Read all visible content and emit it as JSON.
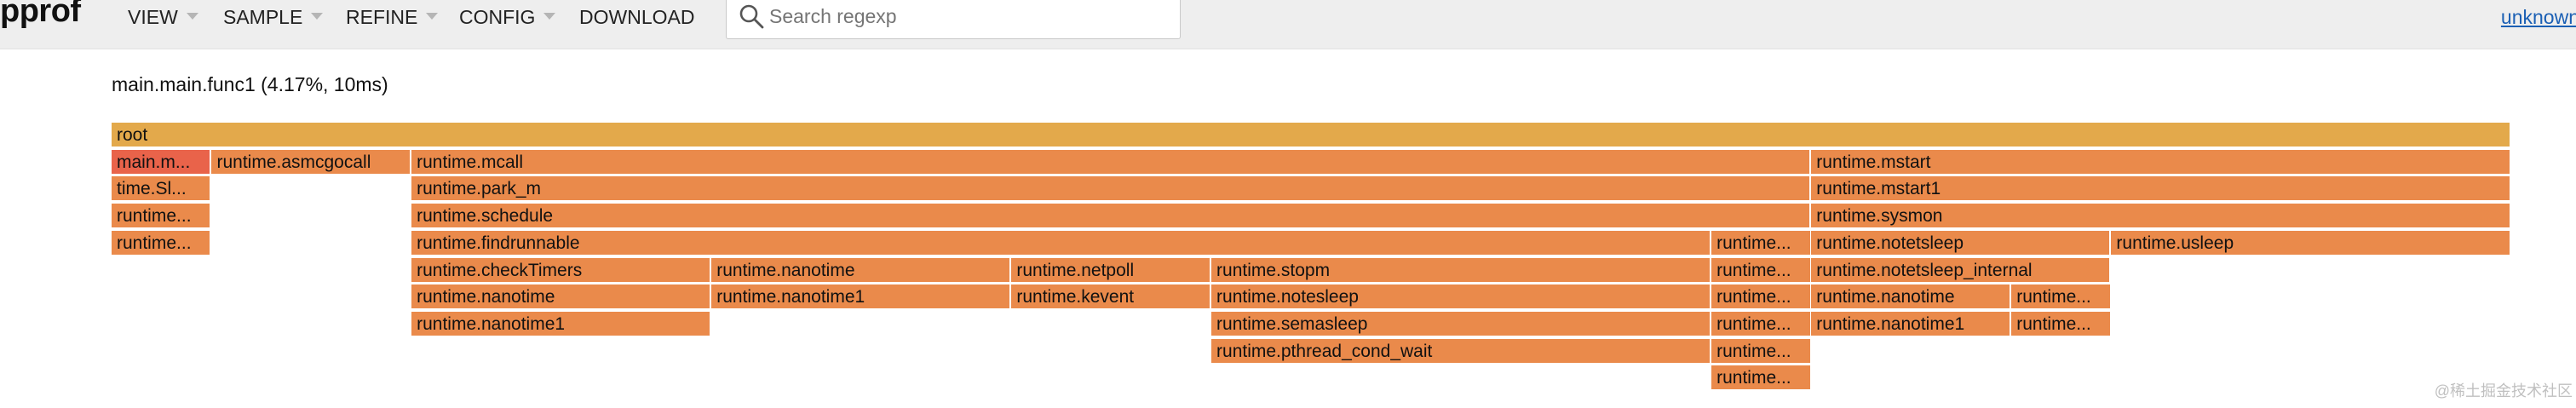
{
  "header": {
    "logo": "pprof",
    "menu": [
      {
        "label": "VIEW"
      },
      {
        "label": "SAMPLE"
      },
      {
        "label": "REFINE"
      },
      {
        "label": "CONFIG"
      },
      {
        "label": "DOWNLOAD"
      }
    ],
    "search": {
      "placeholder": "Search regexp",
      "value": ""
    },
    "user": "unknown"
  },
  "flamegraph": {
    "selected_title": "main.main.func1 (4.17%, 10ms)",
    "colors": {
      "root": "#e3a94b",
      "hot": "#e9634a",
      "warm": "#ea8a4b",
      "mid": "#e88a50"
    },
    "frames": [
      {
        "label": "root",
        "level": 0,
        "start": 0.0,
        "width": 1.0,
        "color": "#e3a94b"
      },
      {
        "label": "main.m...",
        "level": 1,
        "start": 0.0,
        "width": 0.0417,
        "color": "#e9634a"
      },
      {
        "label": "runtime.asmcgocall",
        "level": 1,
        "start": 0.0417,
        "width": 0.0833,
        "color": "#ea8a4b"
      },
      {
        "label": "runtime.mcall",
        "level": 1,
        "start": 0.125,
        "width": 0.5833,
        "color": "#ea8a4b"
      },
      {
        "label": "runtime.mstart",
        "level": 1,
        "start": 0.7083,
        "width": 0.2917,
        "color": "#ea8a4b"
      },
      {
        "label": "time.Sl...",
        "level": 2,
        "start": 0.0,
        "width": 0.0417,
        "color": "#ea8a4b"
      },
      {
        "label": "runtime.park_m",
        "level": 2,
        "start": 0.125,
        "width": 0.5833,
        "color": "#ea8a4b"
      },
      {
        "label": "runtime.mstart1",
        "level": 2,
        "start": 0.7083,
        "width": 0.2917,
        "color": "#ea8a4b"
      },
      {
        "label": "runtime...",
        "level": 3,
        "start": 0.0,
        "width": 0.0417,
        "color": "#ea8a4b"
      },
      {
        "label": "runtime.schedule",
        "level": 3,
        "start": 0.125,
        "width": 0.5833,
        "color": "#ea8a4b"
      },
      {
        "label": "runtime.sysmon",
        "level": 3,
        "start": 0.7083,
        "width": 0.2917,
        "color": "#ea8a4b"
      },
      {
        "label": "runtime...",
        "level": 4,
        "start": 0.0,
        "width": 0.0417,
        "color": "#ea8a4b"
      },
      {
        "label": "runtime.findrunnable",
        "level": 4,
        "start": 0.125,
        "width": 0.5417,
        "color": "#ea8a4b"
      },
      {
        "label": "runtime...",
        "level": 4,
        "start": 0.6667,
        "width": 0.0417,
        "color": "#ea8a4b"
      },
      {
        "label": "runtime.notetsleep",
        "level": 4,
        "start": 0.7083,
        "width": 0.125,
        "color": "#ea8a4b"
      },
      {
        "label": "runtime.usleep",
        "level": 4,
        "start": 0.8333,
        "width": 0.1667,
        "color": "#ea8a4b"
      },
      {
        "label": "runtime.checkTimers",
        "level": 5,
        "start": 0.125,
        "width": 0.125,
        "color": "#ea8a4b"
      },
      {
        "label": "runtime.nanotime",
        "level": 5,
        "start": 0.25,
        "width": 0.125,
        "color": "#ea8a4b"
      },
      {
        "label": "runtime.netpoll",
        "level": 5,
        "start": 0.375,
        "width": 0.0833,
        "color": "#ea8a4b"
      },
      {
        "label": "runtime.stopm",
        "level": 5,
        "start": 0.4583,
        "width": 0.2083,
        "color": "#ea8a4b"
      },
      {
        "label": "runtime...",
        "level": 5,
        "start": 0.6667,
        "width": 0.0417,
        "color": "#ea8a4b"
      },
      {
        "label": "runtime.notetsleep_internal",
        "level": 5,
        "start": 0.7083,
        "width": 0.125,
        "color": "#ea8a4b"
      },
      {
        "label": "runtime.nanotime",
        "level": 6,
        "start": 0.125,
        "width": 0.125,
        "color": "#ea8a4b"
      },
      {
        "label": "runtime.nanotime1",
        "level": 6,
        "start": 0.25,
        "width": 0.125,
        "color": "#ea8a4b"
      },
      {
        "label": "runtime.kevent",
        "level": 6,
        "start": 0.375,
        "width": 0.0833,
        "color": "#ea8a4b"
      },
      {
        "label": "runtime.notesleep",
        "level": 6,
        "start": 0.4583,
        "width": 0.2083,
        "color": "#ea8a4b"
      },
      {
        "label": "runtime...",
        "level": 6,
        "start": 0.6667,
        "width": 0.0417,
        "color": "#ea8a4b"
      },
      {
        "label": "runtime.nanotime",
        "level": 6,
        "start": 0.7083,
        "width": 0.0833,
        "color": "#ea8a4b"
      },
      {
        "label": "runtime...",
        "level": 6,
        "start": 0.7917,
        "width": 0.0417,
        "color": "#ea8a4b"
      },
      {
        "label": "runtime.nanotime1",
        "level": 7,
        "start": 0.125,
        "width": 0.125,
        "color": "#ea8a4b"
      },
      {
        "label": "runtime.semasleep",
        "level": 7,
        "start": 0.4583,
        "width": 0.2083,
        "color": "#ea8a4b"
      },
      {
        "label": "runtime...",
        "level": 7,
        "start": 0.6667,
        "width": 0.0417,
        "color": "#ea8a4b"
      },
      {
        "label": "runtime.nanotime1",
        "level": 7,
        "start": 0.7083,
        "width": 0.0833,
        "color": "#ea8a4b"
      },
      {
        "label": "runtime...",
        "level": 7,
        "start": 0.7917,
        "width": 0.0417,
        "color": "#ea8a4b"
      },
      {
        "label": "runtime.pthread_cond_wait",
        "level": 8,
        "start": 0.4583,
        "width": 0.2083,
        "color": "#ea8a4b"
      },
      {
        "label": "runtime...",
        "level": 8,
        "start": 0.6667,
        "width": 0.0417,
        "color": "#ea8a4b"
      },
      {
        "label": "runtime...",
        "level": 9,
        "start": 0.6667,
        "width": 0.0417,
        "color": "#ea8a4b"
      }
    ]
  },
  "watermark": "@稀土掘金技术社区"
}
